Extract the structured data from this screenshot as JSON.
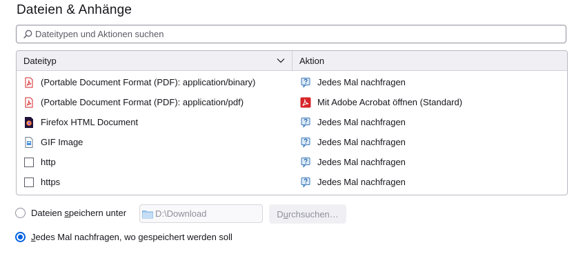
{
  "section": {
    "title": "Dateien & Anhänge"
  },
  "search": {
    "placeholder": "Dateitypen und Aktionen suchen",
    "icon": "search-icon"
  },
  "table": {
    "headers": {
      "type": "Dateityp",
      "action": "Aktion"
    },
    "rows": [
      {
        "type": "(Portable Document Format (PDF): application/binary)",
        "type_icon": "pdf-icon",
        "action": "Jedes Mal nachfragen",
        "action_icon": "ask-icon"
      },
      {
        "type": "(Portable Document Format (PDF): application/pdf)",
        "type_icon": "pdf-icon",
        "action": "Mit Adobe Acrobat öffnen (Standard)",
        "action_icon": "acrobat-icon"
      },
      {
        "type": "Firefox HTML Document",
        "type_icon": "firefox-document-icon",
        "action": "Jedes Mal nachfragen",
        "action_icon": "ask-icon"
      },
      {
        "type": "GIF Image",
        "type_icon": "image-file-icon",
        "action": "Jedes Mal nachfragen",
        "action_icon": "ask-icon"
      },
      {
        "type": "http",
        "type_icon": "blank-file-icon",
        "action": "Jedes Mal nachfragen",
        "action_icon": "ask-icon"
      },
      {
        "type": "https",
        "type_icon": "blank-file-icon",
        "action": "Jedes Mal nachfragen",
        "action_icon": "ask-icon"
      }
    ]
  },
  "downloads": {
    "save_to_prefix": "Dateien ",
    "save_to_accel": "s",
    "save_to_suffix": "peichern unter",
    "path_value": "D:\\Download",
    "browse_prefix": "D",
    "browse_accel": "u",
    "browse_suffix": "rchsuchen…",
    "ask_accel": "J",
    "ask_suffix": "edes Mal nachfragen, wo gespeichert werden soll",
    "selected": "ask"
  },
  "colors": {
    "accent": "#0061e0",
    "pdf_red": "#d6262b",
    "header_bg": "#f0f0f4"
  }
}
